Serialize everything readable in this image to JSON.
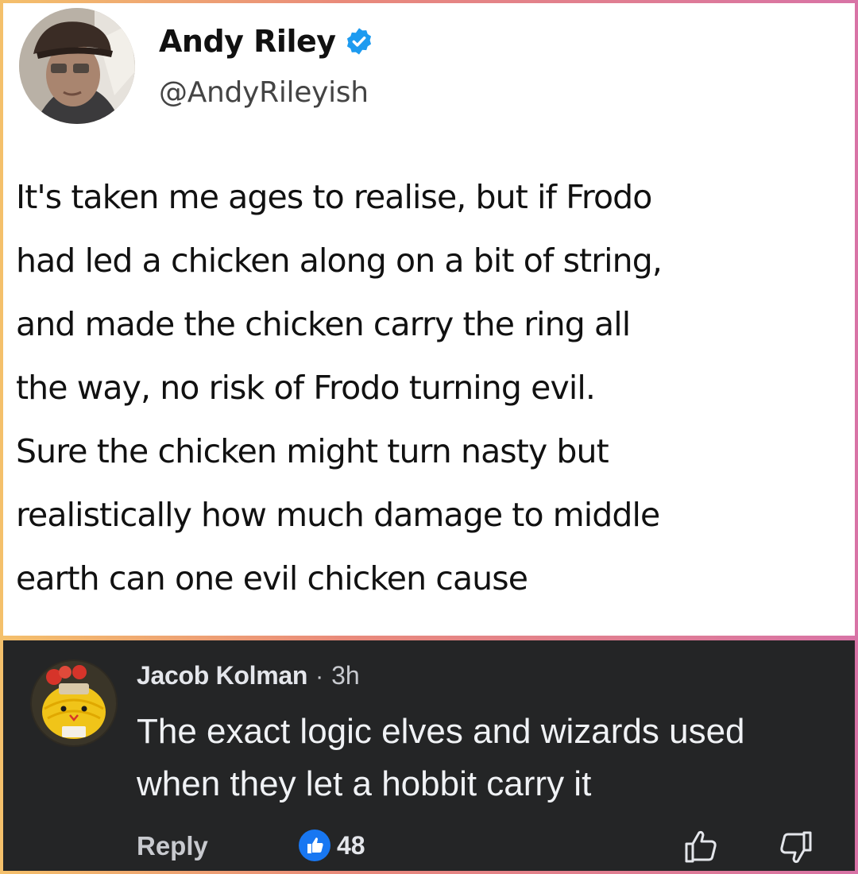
{
  "tweet": {
    "author": {
      "display_name": "Andy Riley",
      "handle": "@AndyRileyish",
      "verified": true,
      "verified_color": "#1d9bf0"
    },
    "text_lines": [
      "It's taken me ages to realise, but if Frodo",
      "had led a chicken along on a bit of string,",
      "and made the chicken carry the ring all",
      "the way, no risk of Frodo turning evil.",
      "Sure the chicken might turn nasty but",
      "realistically how much damage to middle",
      "earth can one evil chicken cause"
    ]
  },
  "comment": {
    "author": "Jacob Kolman",
    "separator": "·",
    "time": "3h",
    "text_lines": [
      "The exact logic elves and wizards used",
      "when they let a hobbit carry it"
    ],
    "reply_label": "Reply",
    "like_count": "48",
    "like_color": "#1877f2",
    "background": "#242526"
  },
  "icons": {
    "verified": "verified-badge-icon",
    "like_badge": "like-thumb-icon",
    "thumb_up": "thumbs-up-icon",
    "thumb_down": "thumbs-down-icon"
  }
}
